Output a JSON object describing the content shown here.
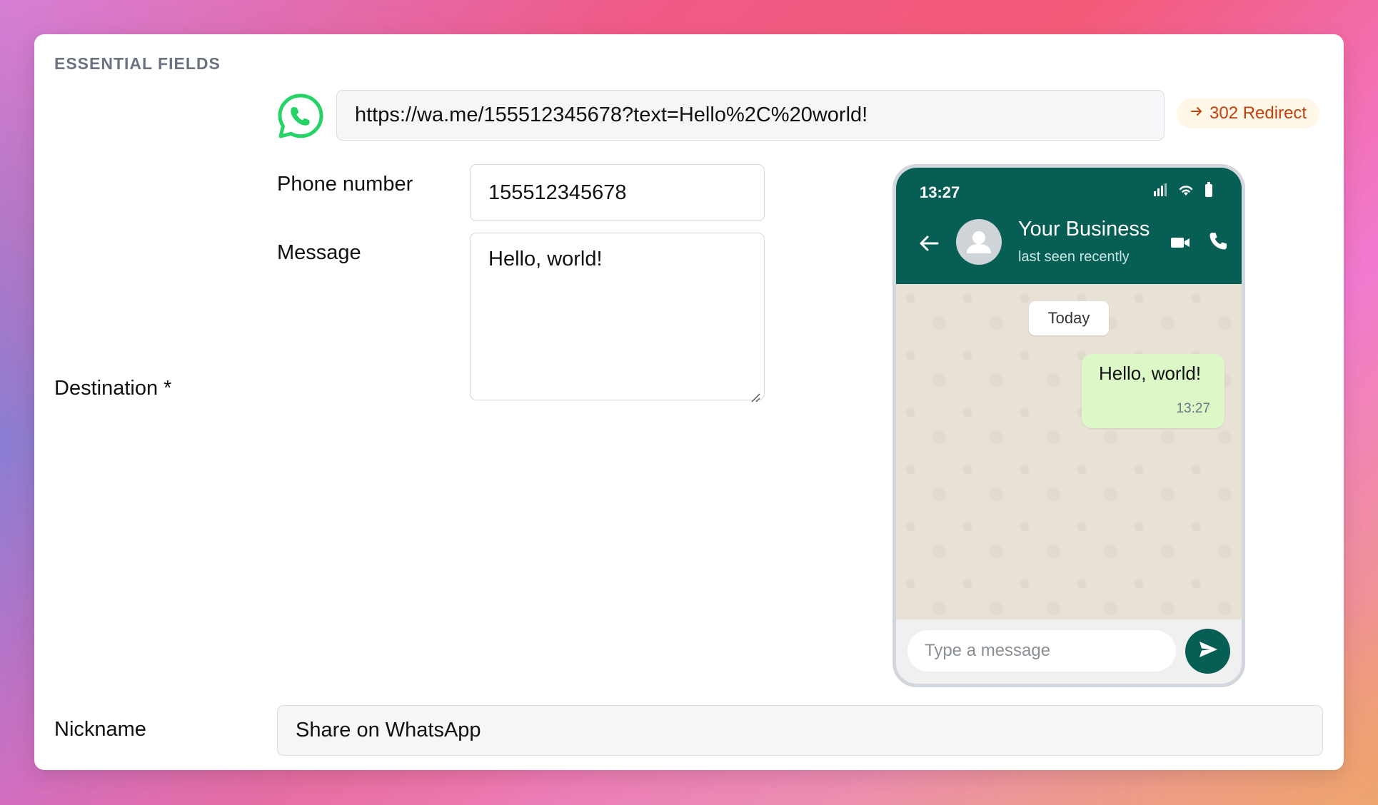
{
  "section": {
    "title": "ESSENTIAL FIELDS"
  },
  "destination": {
    "label": "Destination *",
    "url_value": "https://wa.me/155512345678?text=Hello%2C%20world!",
    "redirect_badge": "302 Redirect",
    "phone_label": "Phone number",
    "phone_value": "155512345678",
    "message_label": "Message",
    "message_value": "Hello, world!"
  },
  "preview": {
    "status_time": "13:27",
    "contact_name": "Your Business",
    "contact_status": "last seen recently",
    "date_chip": "Today",
    "bubble_text": "Hello, world!",
    "bubble_time": "13:27",
    "compose_placeholder": "Type a message"
  },
  "nickname": {
    "label": "Nickname",
    "value": "Share on WhatsApp"
  },
  "colors": {
    "whatsapp_green": "#25d366",
    "whatsapp_teal": "#075e54",
    "bubble": "#dcf8c6",
    "badge_text": "#c2410c",
    "badge_bg": "#fff7e8"
  },
  "icons": [
    "whatsapp-logo-icon",
    "arrow-right-icon",
    "signal-icon",
    "wifi-icon",
    "battery-icon",
    "back-arrow-icon",
    "avatar-person-icon",
    "video-call-icon",
    "phone-call-icon",
    "send-icon",
    "resize-grip-icon"
  ]
}
